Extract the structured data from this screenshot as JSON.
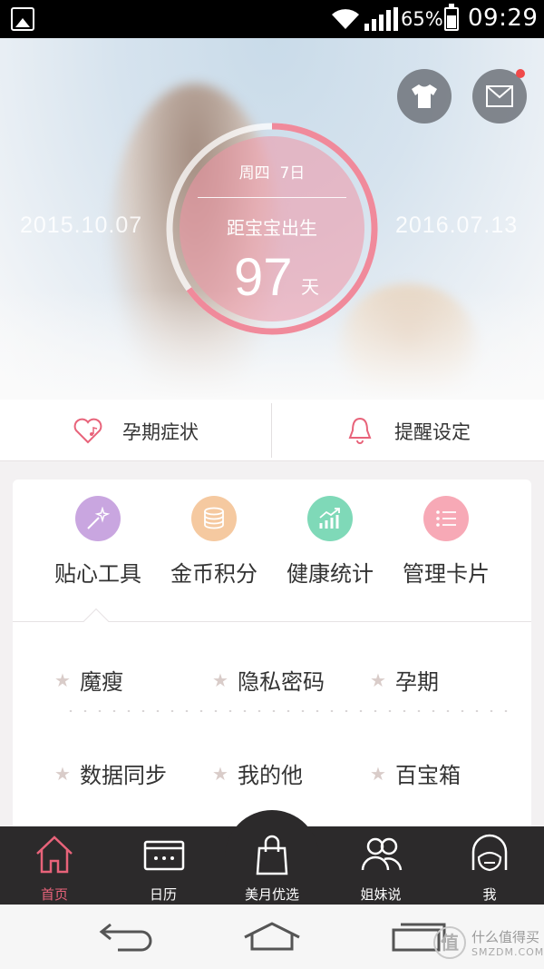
{
  "status_bar": {
    "battery_percent": "65%",
    "time": "09:29",
    "battery_level": 0.65
  },
  "hero": {
    "weekday": "周四",
    "day_label": "7日",
    "countdown_label": "距宝宝出生",
    "days_remaining": "97",
    "days_unit": "天",
    "start_date": "2015.10.07",
    "due_date": "2016.07.13",
    "progress_fraction": 0.65,
    "ring_color": "#f08a9b"
  },
  "quick_actions": [
    {
      "label": "孕期症状",
      "icon": "heart-note-icon"
    },
    {
      "label": "提醒设定",
      "icon": "bell-icon"
    }
  ],
  "tools": [
    {
      "label": "贴心工具",
      "icon": "magic-wand-icon",
      "color": "#c9a6e0"
    },
    {
      "label": "金币积分",
      "icon": "coins-icon",
      "color": "#f5c9a0"
    },
    {
      "label": "健康统计",
      "icon": "chart-icon",
      "color": "#7fd9b8"
    },
    {
      "label": "管理卡片",
      "icon": "list-icon",
      "color": "#f7a9b6"
    }
  ],
  "entries": [
    {
      "label": "魔瘦"
    },
    {
      "label": "隐私密码"
    },
    {
      "label": "孕期"
    },
    {
      "label": "数据同步"
    },
    {
      "label": "我的他"
    },
    {
      "label": "百宝箱"
    }
  ],
  "tab_bar": [
    {
      "label": "首页",
      "icon": "home-icon",
      "active": true
    },
    {
      "label": "日历",
      "icon": "calendar-card-icon",
      "active": false
    },
    {
      "label": "美月优选",
      "icon": "shopping-bag-icon",
      "active": false
    },
    {
      "label": "姐妹说",
      "icon": "people-icon",
      "active": false
    },
    {
      "label": "我",
      "icon": "profile-icon",
      "active": false
    }
  ],
  "watermark": {
    "badge": "值",
    "title": "什么值得买",
    "subtitle": "SMZDM.COM"
  },
  "colors": {
    "accent": "#e8637a",
    "tab_bar_bg": "#2c2a2b"
  }
}
